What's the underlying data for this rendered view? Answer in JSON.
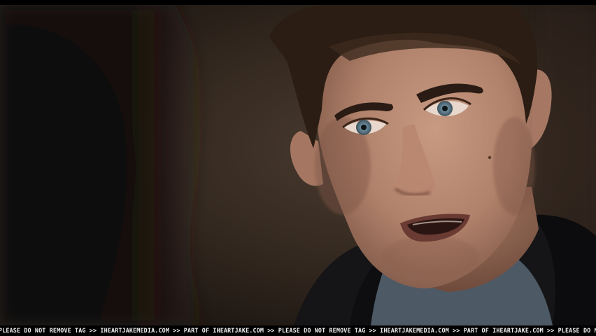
{
  "watermark": {
    "text": "PLEASE DO NOT REMOVE TAG >> IHEARTJAKEMEDIA.COM >> PART OF IHEARTJAKE.COM >> PLEASE DO NOT REMOVE TAG >> IHEARTJAKEMEDIA.COM >> PART OF IHEARTJAKE.COM >> PLEASE DO NOT REMOVE TAG >> IHEARTJAKE"
  },
  "scene": {
    "subject": "close-up film still of a man with short dark hair and blue eyes, mouth open mid-speech, wearing a dark jacket over a blue shirt, with a blurred dark-haired figure in the left foreground",
    "colors": {
      "background_warm": "#3a2e25",
      "background_dark": "#1a130f",
      "skin": "#b98b74",
      "hair": "#2b1d14",
      "jacket": "#151517",
      "shirt": "#4d5a66",
      "eyes": "#6f8fa0"
    }
  }
}
